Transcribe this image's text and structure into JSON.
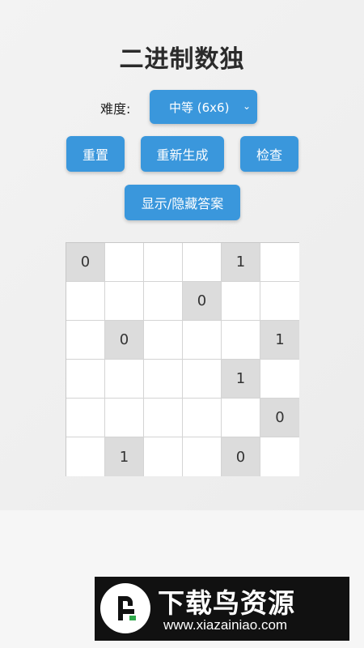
{
  "app": {
    "title": "二进制数独",
    "difficulty_label": "难度:",
    "difficulty_selected": "中等 (6x6)",
    "buttons": {
      "reset": "重置",
      "regenerate": "重新生成",
      "check": "检查",
      "toggle_answer": "显示/隐藏答案"
    },
    "board": [
      [
        "0",
        "",
        "",
        "",
        "1",
        ""
      ],
      [
        "",
        "",
        "",
        "0",
        "",
        ""
      ],
      [
        "",
        "0",
        "",
        "",
        "",
        "1"
      ],
      [
        "",
        "",
        "",
        "",
        "1",
        ""
      ],
      [
        "",
        "",
        "",
        "",
        "",
        "0"
      ],
      [
        "",
        "1",
        "",
        "",
        "0",
        ""
      ]
    ]
  },
  "watermark": {
    "title": "下载鸟资源",
    "url": "www.xiazainiao.com",
    "logo_icon": "bird-logo-icon"
  },
  "colors": {
    "accent": "#3a97dc",
    "given_cell": "#dcdcdc",
    "empty_cell": "#ffffff"
  }
}
